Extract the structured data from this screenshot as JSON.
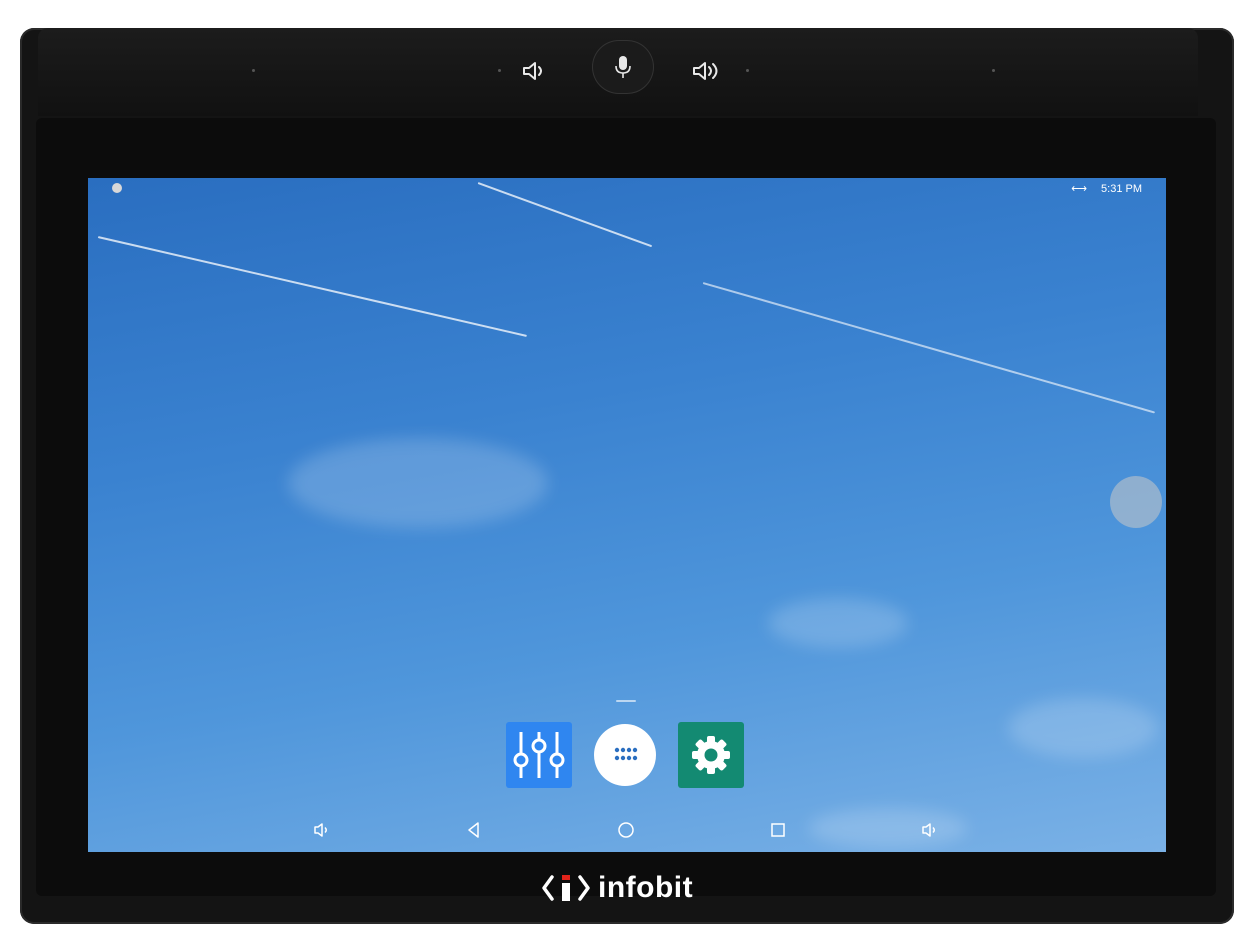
{
  "device": {
    "brand_name": "infobit",
    "hardware_buttons": {
      "volume_down_icon": "speaker-low-icon",
      "mic_icon": "microphone-icon",
      "volume_up_icon": "speaker-high-icon"
    }
  },
  "status_bar": {
    "connection_icon": "link-arrows-icon",
    "connection_glyph": "⟷",
    "time": "5:31 PM"
  },
  "dock": {
    "apps": [
      {
        "name": "mixer",
        "icon": "sliders-icon",
        "color": "#2f86f0"
      },
      {
        "name": "all-apps",
        "icon": "app-drawer-icon",
        "color": "#ffffff"
      },
      {
        "name": "settings",
        "icon": "gear-icon",
        "color": "#138a72"
      }
    ]
  },
  "nav_bar": {
    "items": [
      "volume-down-icon",
      "back-icon",
      "home-icon",
      "recents-icon",
      "volume-up-icon"
    ]
  },
  "colors": {
    "sky_top": "#2a6ec0",
    "sky_bottom": "#7ab1e6",
    "bezel": "#0c0c0c"
  }
}
